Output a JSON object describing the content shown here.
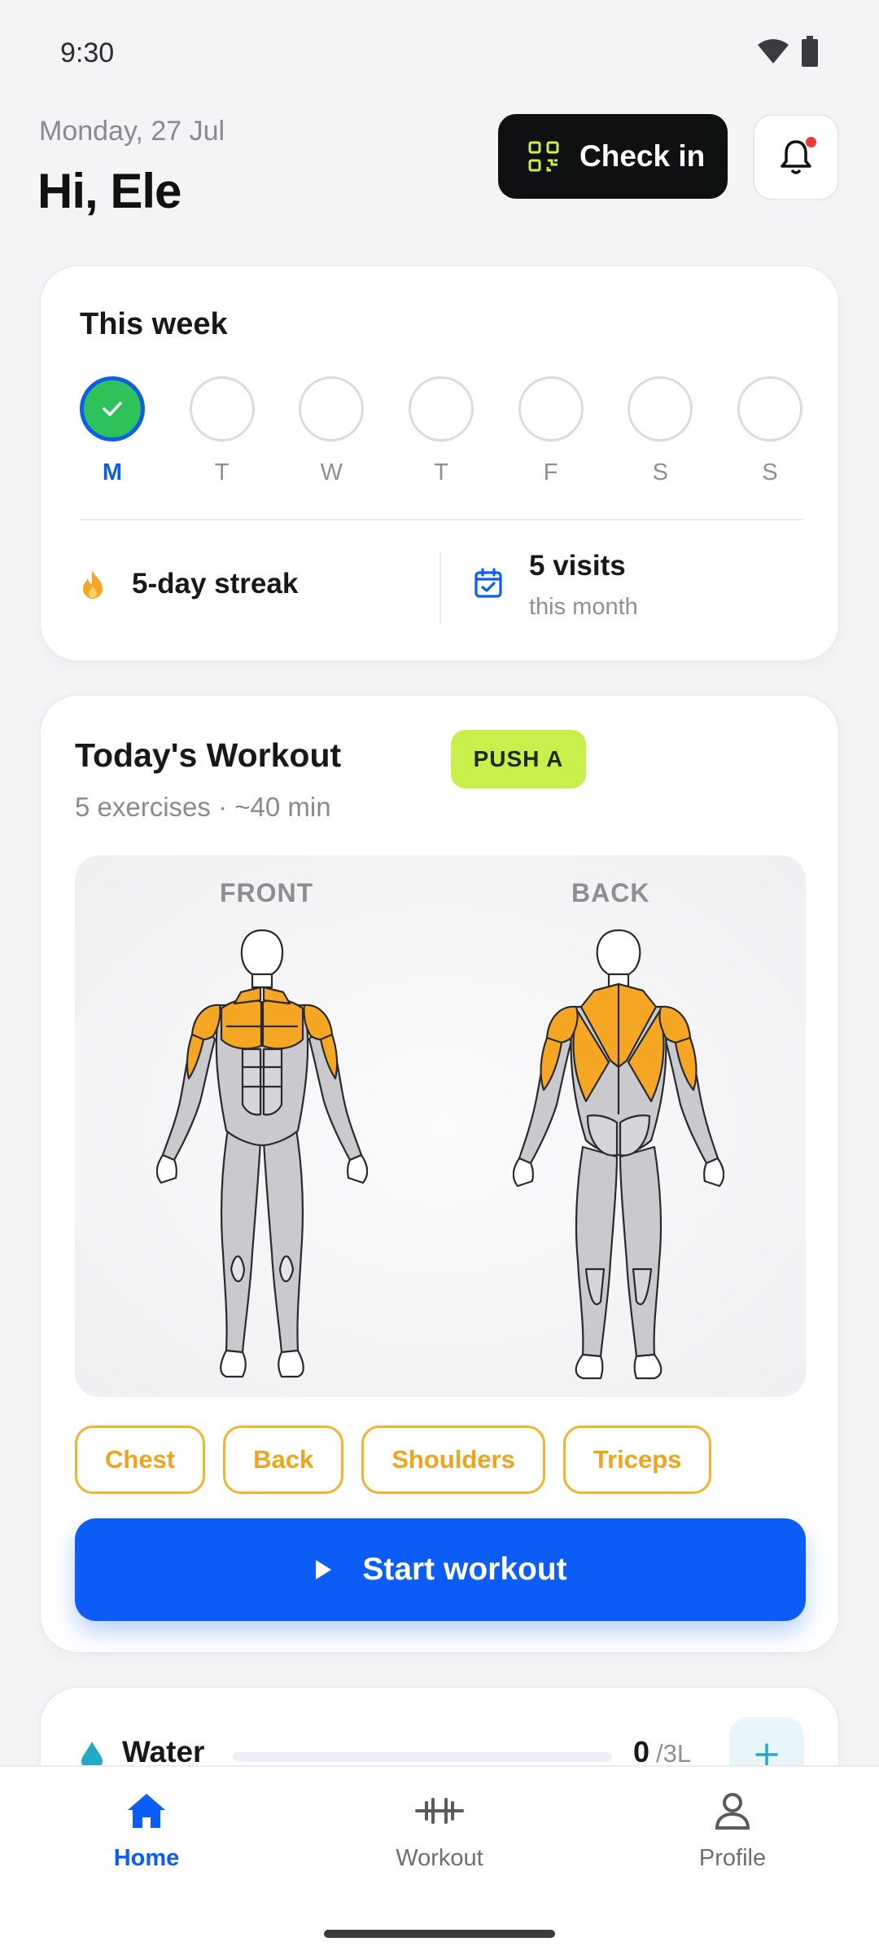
{
  "status_bar": {
    "time": "9:30"
  },
  "header": {
    "date": "Monday, 27 Jul",
    "greeting": "Hi, Ele",
    "checkin_label": "Check in"
  },
  "week": {
    "title": "This week",
    "days": [
      {
        "label": "M",
        "done": true
      },
      {
        "label": "T",
        "done": false
      },
      {
        "label": "W",
        "done": false
      },
      {
        "label": "T",
        "done": false
      },
      {
        "label": "F",
        "done": false
      },
      {
        "label": "S",
        "done": false
      },
      {
        "label": "S",
        "done": false
      }
    ],
    "streak": "5-day streak",
    "visits_title": "5 visits",
    "visits_sub": "this month"
  },
  "workout": {
    "title": "Today's Workout",
    "badge": "PUSH A",
    "subtitle": "5 exercises · ~40 min",
    "front_label": "FRONT",
    "back_label": "BACK",
    "tags": [
      "Chest",
      "Back",
      "Shoulders",
      "Triceps"
    ],
    "start_label": "Start workout"
  },
  "water": {
    "label": "Water",
    "value": "0",
    "unit": "/3L",
    "progress": 0
  },
  "nav": {
    "items": [
      {
        "label": "Home",
        "active": true
      },
      {
        "label": "Workout",
        "active": false
      },
      {
        "label": "Profile",
        "active": false
      }
    ]
  },
  "colors": {
    "accent_blue": "#0c5cf8",
    "highlight_orange": "#f5a623",
    "badge_lime": "#c8f04a",
    "done_green": "#30c25a"
  }
}
